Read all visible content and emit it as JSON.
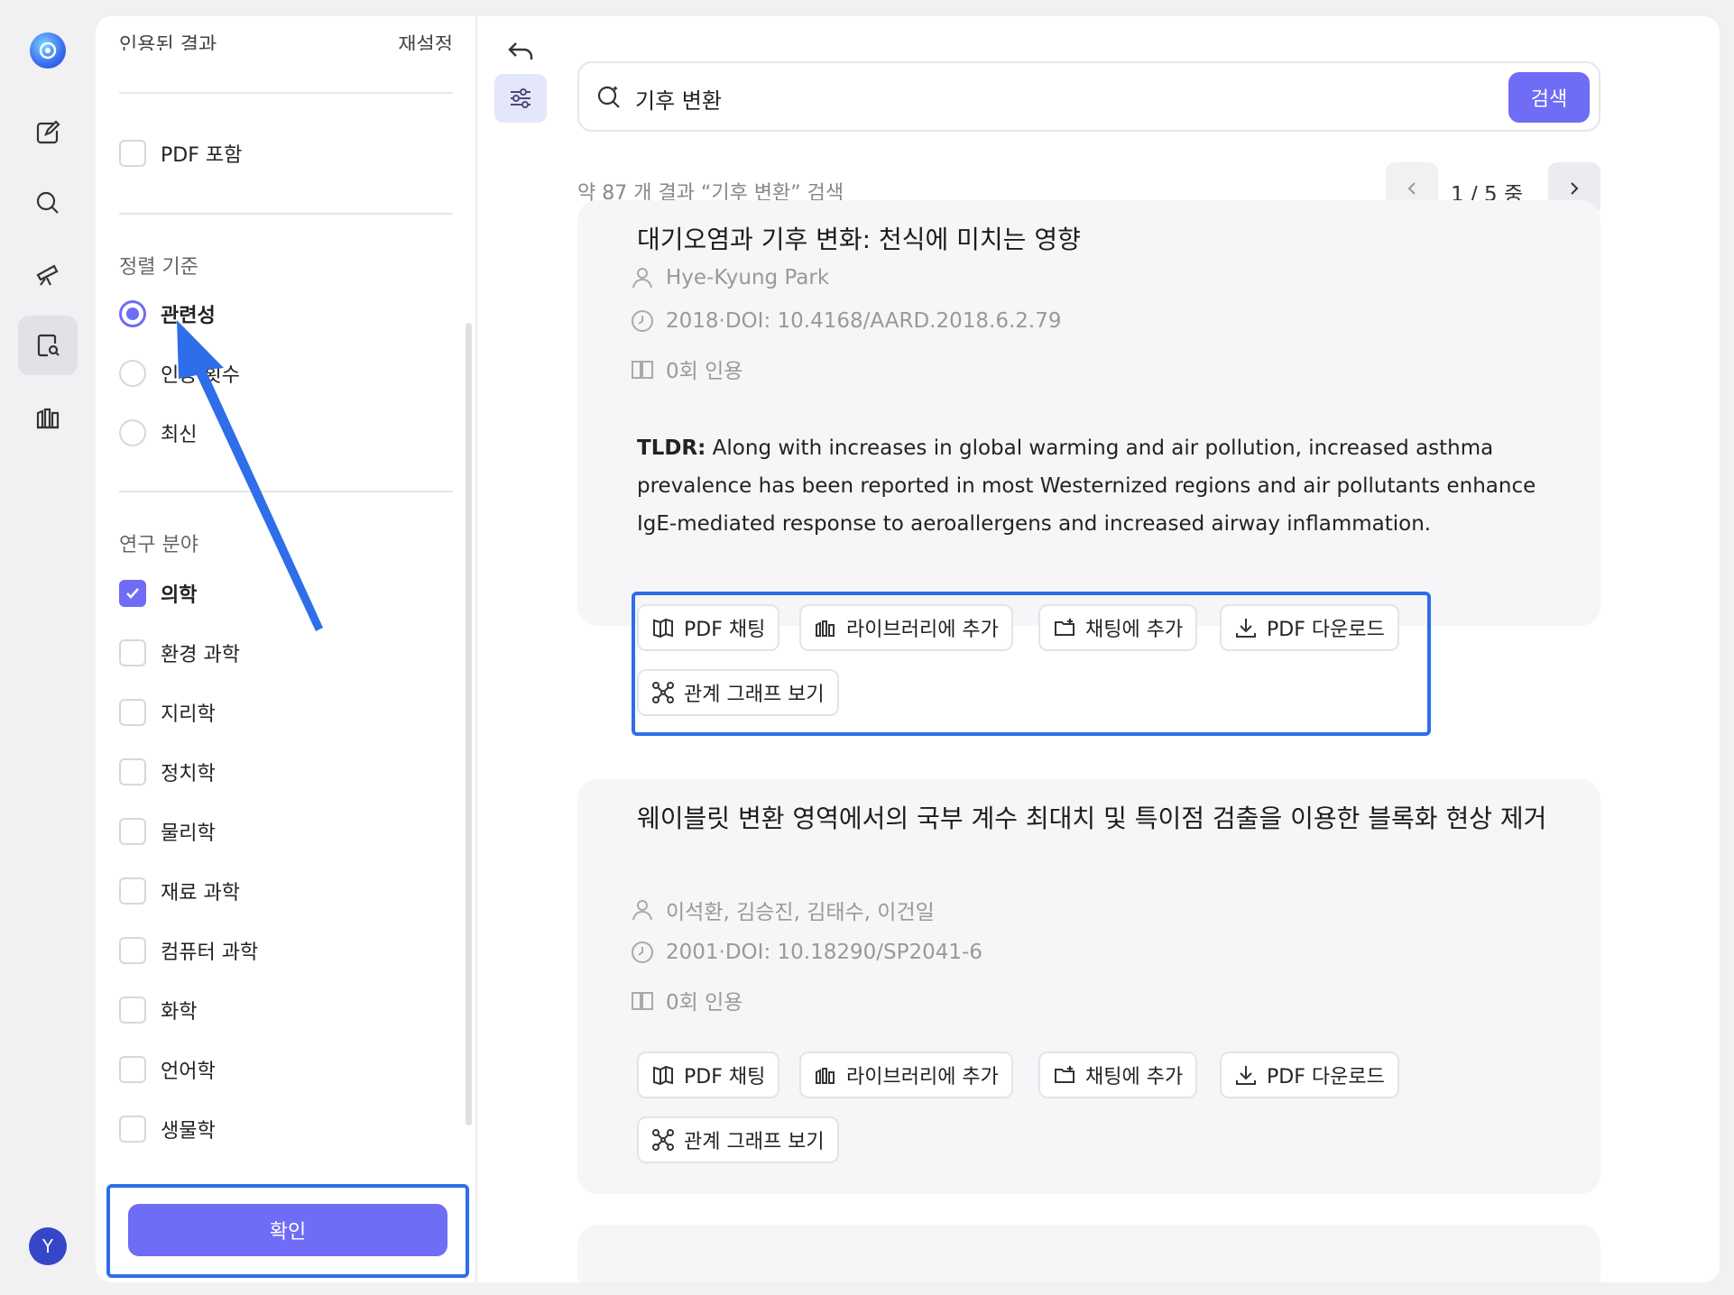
{
  "rail": {
    "icons": [
      "logo-icon",
      "edit-icon",
      "search-icon",
      "telescope-icon",
      "doc-search-icon",
      "library-icon"
    ],
    "avatar_initial": "Y"
  },
  "filter": {
    "top_left": "인용된 결과",
    "top_right": "재설정",
    "pdf_include": "PDF 포함",
    "sort_title": "정렬 기준",
    "sort_options": [
      {
        "label": "관련성",
        "selected": true
      },
      {
        "label": "인용 횟수",
        "selected": false
      },
      {
        "label": "최신",
        "selected": false
      }
    ],
    "field_title": "연구 분야",
    "fields": [
      {
        "label": "의학",
        "checked": true
      },
      {
        "label": "환경 과학",
        "checked": false
      },
      {
        "label": "지리학",
        "checked": false
      },
      {
        "label": "정치학",
        "checked": false
      },
      {
        "label": "물리학",
        "checked": false
      },
      {
        "label": "재료 과학",
        "checked": false
      },
      {
        "label": "컴퓨터 과학",
        "checked": false
      },
      {
        "label": "화학",
        "checked": false
      },
      {
        "label": "언어학",
        "checked": false
      },
      {
        "label": "생물학",
        "checked": false
      }
    ],
    "confirm_label": "확인"
  },
  "search": {
    "query": "기후 변환",
    "button_label": "검색"
  },
  "results": {
    "count_text": "약 87 개 결과 “기후 변환” 검색",
    "pager": "1  / 5 중",
    "items": [
      {
        "title": "대기오염과 기후 변화: 천식에 미치는 영향",
        "authors": "Hye-Kyung Park",
        "year_doi": "2018·DOI: 10.4168/AARD.2018.6.2.79",
        "citations": "0회 인용",
        "tldr_label": "TLDR:",
        "tldr": " Along with increases in global warming and air pollution, increased asthma prevalence has been reported in most Westernized regions and air pollutants enhance IgE-mediated response to aeroallergens and increased airway inflammation."
      },
      {
        "title": "웨이블릿 변환 영역에서의 국부 계수 최대치 및 특이점 검출을 이용한 블록화 현상 제거",
        "authors": "이석환, 김승진, 김태수, 이건일",
        "year_doi": "2001·DOI: 10.18290/SP2041-6",
        "citations": "0회 인용"
      }
    ],
    "actions": {
      "pdf_chat": "PDF 채팅",
      "add_library": "라이브러리에 추가",
      "add_chat": "채팅에 추가",
      "pdf_download": "PDF 다운로드",
      "relation_graph": "관계 그래프 보기"
    }
  },
  "colors": {
    "accent": "#6f6cf6",
    "highlight": "#2e6ee8"
  }
}
